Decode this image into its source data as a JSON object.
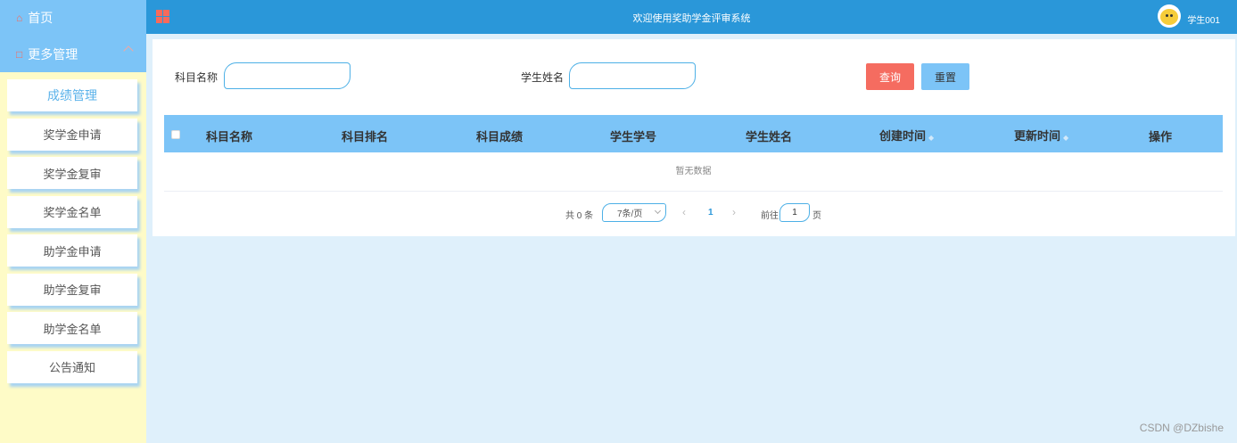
{
  "sidebar": {
    "home_label": "首页",
    "more_label": "更多管理",
    "items": [
      {
        "label": "成绩管理"
      },
      {
        "label": "奖学金申请"
      },
      {
        "label": "奖学金复审"
      },
      {
        "label": "奖学金名单"
      },
      {
        "label": "助学金申请"
      },
      {
        "label": "助学金复审"
      },
      {
        "label": "助学金名单"
      },
      {
        "label": "公告通知"
      }
    ]
  },
  "header": {
    "title": "欢迎使用奖助学金评审系统",
    "username": "学生001"
  },
  "search": {
    "subject_label": "科目名称",
    "subject_value": "",
    "student_label": "学生姓名",
    "student_value": "",
    "query_button": "查询",
    "reset_button": "重置"
  },
  "table": {
    "columns": [
      "科目名称",
      "科目排名",
      "科目成绩",
      "学生学号",
      "学生姓名",
      "创建时间",
      "更新时间",
      "操作"
    ],
    "empty_text": "暂无数据"
  },
  "pagination": {
    "total_text": "共 0 条",
    "page_size": "7条/页",
    "current_page": "1",
    "goto_label": "前往",
    "goto_value": "1",
    "page_suffix": "页"
  },
  "watermark": "CSDN @DZbishe",
  "colors": {
    "header": "#2a97d9",
    "sidebar_top": "#7cc4f7",
    "sidebar_bg": "#fefbc7",
    "query_btn": "#f56c60",
    "reset_btn": "#7cc4f7"
  }
}
